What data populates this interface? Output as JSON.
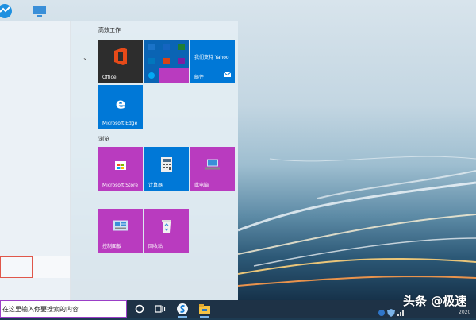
{
  "start_menu": {
    "groups": [
      {
        "label": "高效工作"
      },
      {
        "label": "浏览"
      }
    ],
    "tiles": {
      "office": {
        "label": "Office"
      },
      "mail": {
        "label": "邮件",
        "caption": "我们支持 Yahoo"
      },
      "edge": {
        "label": "Microsoft Edge"
      },
      "store": {
        "label": "Microsoft Store"
      },
      "calculator": {
        "label": "计算器"
      },
      "this_pc": {
        "label": "此电脑"
      },
      "control_panel": {
        "label": "控制面板"
      },
      "recycle_bin": {
        "label": "回收站"
      }
    }
  },
  "taskbar": {
    "search_placeholder": "在这里输入你要搜索的内容"
  },
  "watermark": {
    "text": "头条 @极速"
  },
  "clock": {
    "year": "2020"
  },
  "colors": {
    "tile_blue": "#0078d7",
    "tile_purple": "#b93bbf",
    "office_tile": "#2d2d2d",
    "taskbar": "#1e3246"
  }
}
